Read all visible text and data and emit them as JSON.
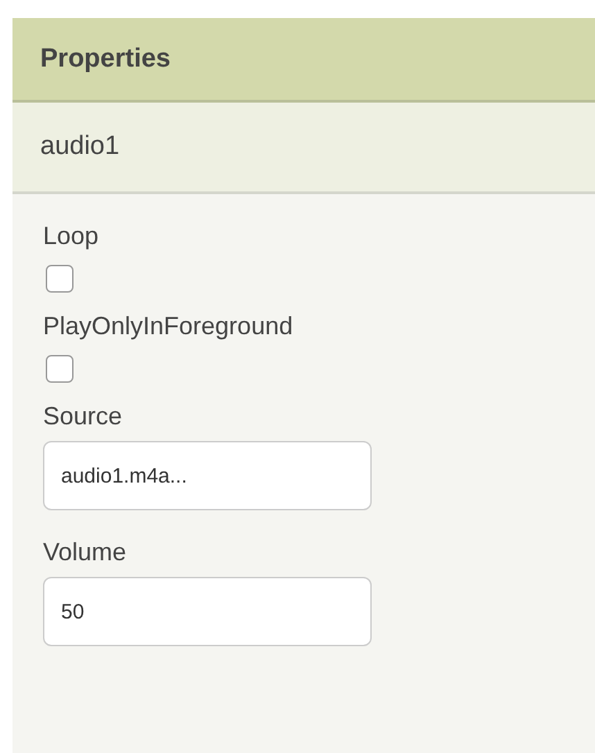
{
  "panel": {
    "title": "Properties",
    "component": "audio1"
  },
  "properties": [
    {
      "kind": "checkbox",
      "label": "Loop",
      "checked": false
    },
    {
      "kind": "checkbox",
      "label": "PlayOnlyInForeground",
      "checked": false
    },
    {
      "kind": "text",
      "label": "Source",
      "value": "audio1.m4a..."
    },
    {
      "kind": "text",
      "label": "Volume",
      "value": "50"
    }
  ]
}
